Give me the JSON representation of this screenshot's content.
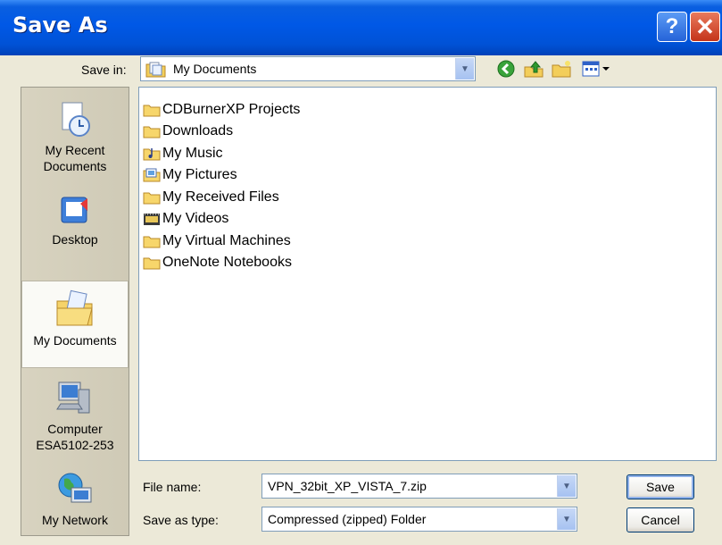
{
  "window": {
    "title": "Save As",
    "help_label": "?",
    "close_label": "✕"
  },
  "toolbar": {
    "save_in_label": "Save in:",
    "save_in_value": "My Documents",
    "icons": [
      "back-icon",
      "up-folder-icon",
      "new-folder-icon",
      "views-menu-icon"
    ]
  },
  "places": [
    {
      "label_lines": [
        "My Recent",
        "Documents"
      ],
      "icon": "recent-documents-icon"
    },
    {
      "label_lines": [
        "Desktop"
      ],
      "icon": "desktop-icon"
    },
    {
      "label_lines": [
        "My Documents"
      ],
      "icon": "my-documents-icon",
      "selected": true
    },
    {
      "label_lines": [
        "Computer",
        "ESA5102-253"
      ],
      "icon": "computer-icon"
    },
    {
      "label_lines": [
        "My Network"
      ],
      "icon": "network-icon"
    }
  ],
  "files": [
    {
      "name": "CDBurnerXP Projects",
      "icon": "folder-icon"
    },
    {
      "name": "Downloads",
      "icon": "folder-icon"
    },
    {
      "name": "My Music",
      "icon": "music-folder-icon"
    },
    {
      "name": "My Pictures",
      "icon": "pictures-folder-icon"
    },
    {
      "name": "My Received Files",
      "icon": "folder-icon"
    },
    {
      "name": "My Videos",
      "icon": "videos-folder-icon"
    },
    {
      "name": "My Virtual Machines",
      "icon": "folder-icon"
    },
    {
      "name": "OneNote Notebooks",
      "icon": "folder-icon"
    }
  ],
  "form": {
    "file_name_label": "File name:",
    "file_name_value": "VPN_32bit_XP_VISTA_7.zip",
    "save_type_label": "Save as type:",
    "save_type_value": "Compressed (zipped) Folder"
  },
  "buttons": {
    "save": "Save",
    "cancel": "Cancel"
  },
  "colors": {
    "titlebar": "#0052D6",
    "dialog_bg": "#ECE9D8",
    "folder": "#F7D66B",
    "selection_border": "#B9B5A4"
  }
}
